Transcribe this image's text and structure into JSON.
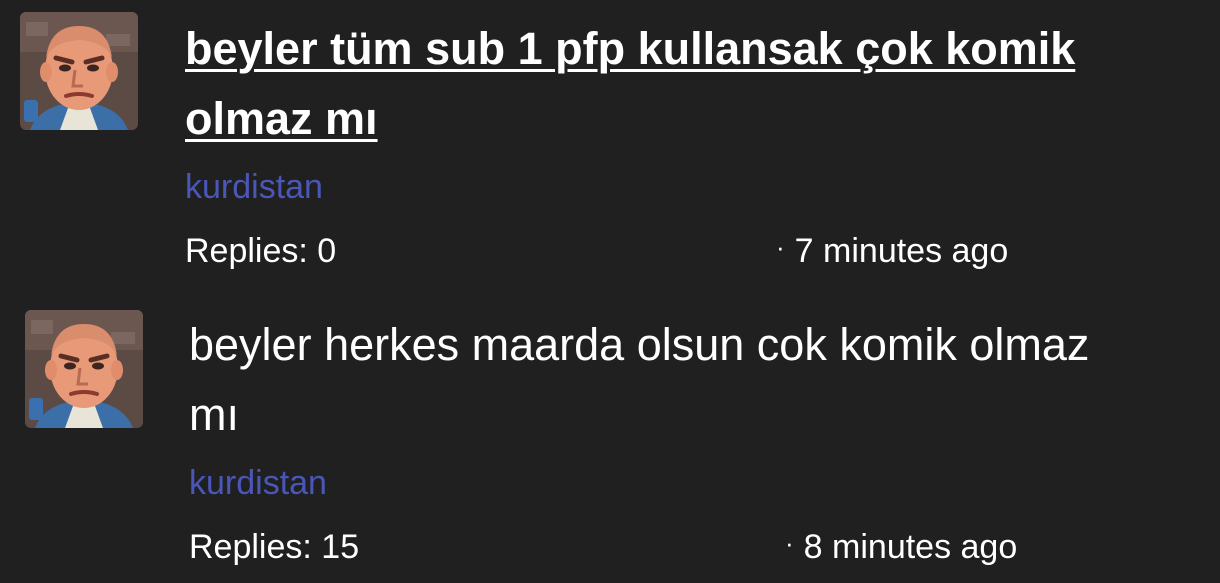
{
  "colors": {
    "background": "#202020",
    "text": "#ffffff",
    "author_link": "#4a56b8"
  },
  "posts": [
    {
      "avatar_icon": "cartoon-face-avatar-icon",
      "title": "beyler tüm sub 1 pfp kullansak çok komik olmaz mı",
      "author": "kurdistan",
      "replies": "Replies: 0",
      "time_separator": "·",
      "time": "7 minutes ago"
    },
    {
      "avatar_icon": "cartoon-face-avatar-icon",
      "title": "beyler herkes maarda olsun cok komik olmaz mı",
      "author": "kurdistan",
      "replies": "Replies: 15",
      "time_separator": "·",
      "time": "8 minutes ago"
    }
  ]
}
